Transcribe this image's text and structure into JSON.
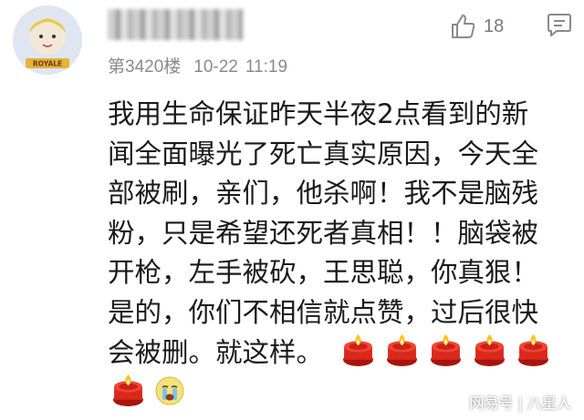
{
  "comment": {
    "avatar_text": "ROYALE",
    "username": "",
    "floor": "第3420楼",
    "date": "10-22",
    "time": "11:19",
    "like_count": "18",
    "lines": [
      "我用生命保证昨天半夜2点看到的新",
      "闻全面曝光了死亡真实原因，今天全",
      "部被刷，亲们，他杀啊！我不是脑残",
      "粉，只是希望还死者真相！！脑袋被",
      "开枪，左手被砍，王思聪，你真狠！",
      "是的，你们不相信就点赞，过后很快",
      "会被删。就这样。"
    ],
    "emojis": [
      "candle-emoji",
      "candle-emoji",
      "candle-emoji",
      "candle-emoji",
      "candle-emoji",
      "candle-emoji",
      "crying-face-emoji"
    ]
  },
  "icons": {
    "like": "thumbs-up-icon",
    "reply": "speech-bubble-icon"
  },
  "colors": {
    "text": "#1a1a1a",
    "meta": "#8a8a8a",
    "candle": "#d9291c",
    "flame": "#ffc21a"
  },
  "watermark": "网易号 | 八星人"
}
